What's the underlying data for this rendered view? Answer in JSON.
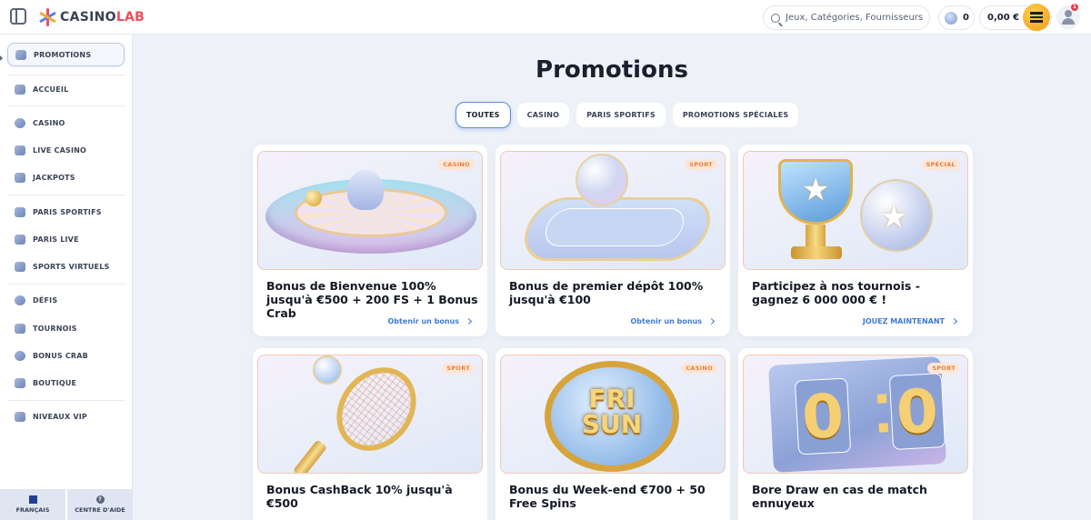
{
  "header": {
    "brand": {
      "part1": "CASINO",
      "part2": "LAB"
    },
    "search_placeholder": "Jeux, Catégories, Fournisseurs",
    "coins_value": "0",
    "balance": "0,00 €",
    "notifications_count": "1"
  },
  "sidebar": {
    "items": [
      {
        "label": "PROMOTIONS",
        "icon": "megaphone-icon"
      },
      {
        "label": "ACCUEIL",
        "icon": "home-icon"
      },
      {
        "label": "CASINO",
        "icon": "casino-chip-icon"
      },
      {
        "label": "LIVE CASINO",
        "icon": "live-camera-icon"
      },
      {
        "label": "JACKPOTS",
        "icon": "jackpot-icon"
      },
      {
        "label": "PARIS SPORTIFS",
        "icon": "sports-ticket-icon"
      },
      {
        "label": "PARIS LIVE",
        "icon": "live-bet-icon"
      },
      {
        "label": "SPORTS VIRTUELS",
        "icon": "virtual-sports-icon"
      },
      {
        "label": "DÉFIS",
        "icon": "challenge-icon"
      },
      {
        "label": "TOURNOIS",
        "icon": "trophy-icon"
      },
      {
        "label": "BONUS CRAB",
        "icon": "crab-icon"
      },
      {
        "label": "BOUTIQUE",
        "icon": "shop-icon"
      },
      {
        "label": "NIVEAUX VIP",
        "icon": "vip-crown-icon"
      }
    ],
    "footer": {
      "language": "FRANÇAIS",
      "help": "CENTRE D'AIDE"
    }
  },
  "main": {
    "title": "Promotions",
    "tabs": [
      {
        "label": "TOUTES",
        "active": true
      },
      {
        "label": "CASINO",
        "active": false
      },
      {
        "label": "PARIS SPORTIFS",
        "active": false
      },
      {
        "label": "PROMOTIONS SPÉCIALES",
        "active": false
      }
    ],
    "cards": [
      {
        "badge": "CASINO",
        "title": "Bonus de Bienvenue 100% jusqu'à €500 + 200 FS + 1 Bonus Crab",
        "link": "Obtenir un bonus",
        "image": "roulette-wheel"
      },
      {
        "badge": "SPORT",
        "title": "Bonus de premier dépôt 100% jusqu'à €100",
        "link": "Obtenir un bonus",
        "image": "football-stadium"
      },
      {
        "badge": "SPÉCIAL",
        "title": "Participez à nos tournois - gagnez 6 000 000 € !",
        "link": "JOUEZ MAINTENANT",
        "image": "trophy-and-ball"
      },
      {
        "badge": "SPORT",
        "title": "Bonus CashBack 10% jusqu'à €500",
        "link": "",
        "image": "tennis-racket"
      },
      {
        "badge": "CASINO",
        "title": "Bonus du Week-end €700 + 50 Free Spins",
        "link": "",
        "image": "fri-sun-coin",
        "image_text": {
          "line1": "FRI",
          "line2": "SUN"
        }
      },
      {
        "badge": "SPORT",
        "title": "Bore Draw en cas de match ennuyeux",
        "link": "",
        "image": "scoreboard",
        "image_text": {
          "left": "0",
          "right": "0"
        }
      }
    ]
  },
  "colors": {
    "accent_blue": "#3f7ad6",
    "badge_orange": "#e4803c",
    "wallet_gold": "#f09a16"
  }
}
